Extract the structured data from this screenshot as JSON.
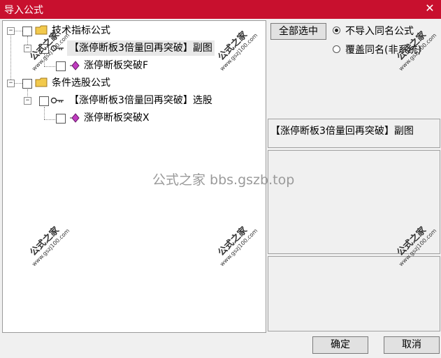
{
  "window": {
    "title": "导入公式",
    "close_icon": "close-icon"
  },
  "tree": {
    "groups": [
      {
        "label": "技术指标公式",
        "icon": "folder-icon",
        "children": [
          {
            "label": "【涨停断板3倍量回再突破】副图",
            "icon": "key-icon",
            "selected": true,
            "children": [
              {
                "label": "涨停断板突破F",
                "icon": "gem-icon"
              }
            ]
          }
        ]
      },
      {
        "label": "条件选股公式",
        "icon": "folder-icon",
        "children": [
          {
            "label": "【涨停断板3倍量回再突破】选股",
            "icon": "key-icon",
            "children": [
              {
                "label": "涨停断板突破X",
                "icon": "gem-icon"
              }
            ]
          }
        ]
      }
    ]
  },
  "toolbar": {
    "select_all_label": "全部选中"
  },
  "options": {
    "no_import_label": "不导入同名公式",
    "overwrite_label": "覆盖同名(非系统)",
    "selected": "no_import"
  },
  "detail": {
    "name": "【涨停断板3倍量回再突破】副图"
  },
  "buttons": {
    "ok_label": "确定",
    "cancel_label": "取消"
  },
  "watermark": {
    "center_text": "公式之家 bbs.gszb.top",
    "stamp_text": "公式之家",
    "stamp_url": "www.gszj100.com"
  },
  "colors": {
    "titlebar": "#c8102e",
    "gem": "#c03cc0",
    "folder": "#f2c94c"
  }
}
